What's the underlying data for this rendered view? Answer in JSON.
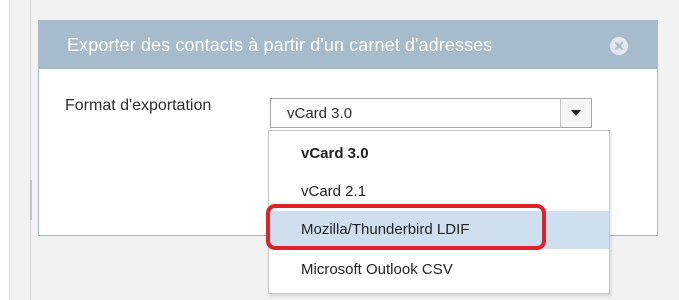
{
  "dialog": {
    "title": "Exporter des contacts à partir d'un carnet d'adresses",
    "close_icon": "close-circle-icon"
  },
  "form": {
    "label": "Format d'exportation",
    "selected_value": "vCard 3.0",
    "arrow_icon": "caret-down-icon"
  },
  "dropdown": {
    "options": [
      {
        "label": "vCard 3.0",
        "selected": true
      },
      {
        "label": "vCard 2.1",
        "selected": false
      },
      {
        "label": "Mozilla/Thunderbird LDIF",
        "selected": false,
        "hovered": true
      },
      {
        "label": "Microsoft Outlook CSV",
        "selected": false
      }
    ]
  },
  "annotation": {
    "highlight_color": "#e0212a"
  },
  "colors": {
    "header": "#a6bccd",
    "hover": "#cfdff0"
  }
}
